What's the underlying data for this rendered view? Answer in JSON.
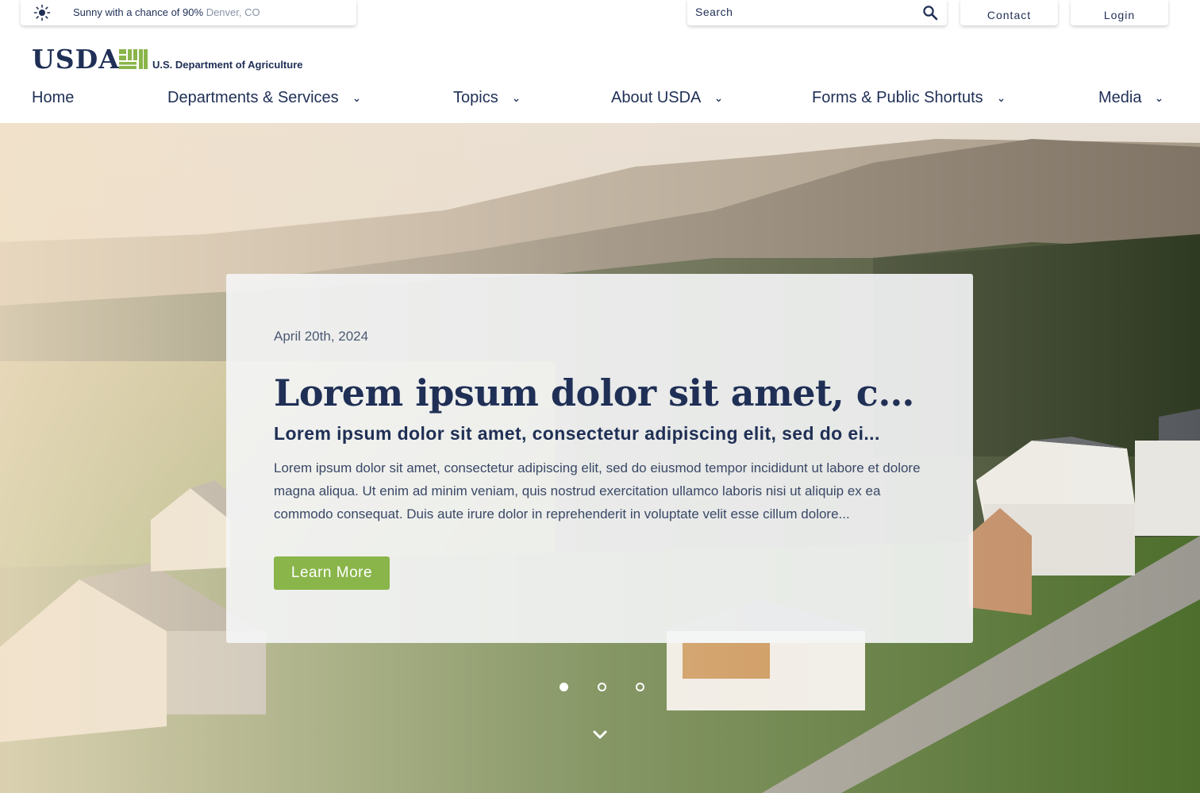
{
  "weather": {
    "icon": "sun-icon",
    "text": "Sunny with a chance of 90%",
    "location": "Denver, CO"
  },
  "search": {
    "placeholder": "Search",
    "icon": "search-icon"
  },
  "utility": {
    "contact_label": "Contact",
    "login_label": "Login"
  },
  "logo": {
    "wordmark": "USDA",
    "department": "U.S. Department of Agriculture",
    "mark_color": "#8ab54a"
  },
  "nav": {
    "items": [
      {
        "label": "Home"
      },
      {
        "label": "Departments & Services",
        "icon": "chevron-down-icon"
      },
      {
        "label": "Topics",
        "icon": "chevron-down-icon"
      },
      {
        "label": "About USDA",
        "icon": "chevron-down-icon"
      },
      {
        "label": "Forms & Public Shortuts",
        "icon": "chevron-down-icon"
      },
      {
        "label": "Media",
        "icon": "chevron-down-icon"
      }
    ]
  },
  "hero": {
    "date": "April 20th, 2024",
    "headline": "Lorem ipsum dolor sit amet, con...",
    "subheadline": "Lorem ipsum dolor sit amet, consectetur adipiscing elit, sed do ei...",
    "body": "Lorem ipsum dolor sit amet, consectetur adipiscing elit, sed do eiusmod tempor incididunt ut labore et dolore magna aliqua. Ut enim ad minim veniam, quis nostrud exercitation ullamco laboris nisi ut aliquip ex ea commodo consequat. Duis aute irure dolor in reprehenderit in voluptate velit esse cillum dolore...",
    "cta_label": "Learn More",
    "slide_count": 3,
    "active_slide": 1,
    "scroll_icon": "chevron-down-icon"
  },
  "colors": {
    "navy": "#1f2f55",
    "green": "#8ab54a",
    "white": "#ffffff"
  }
}
